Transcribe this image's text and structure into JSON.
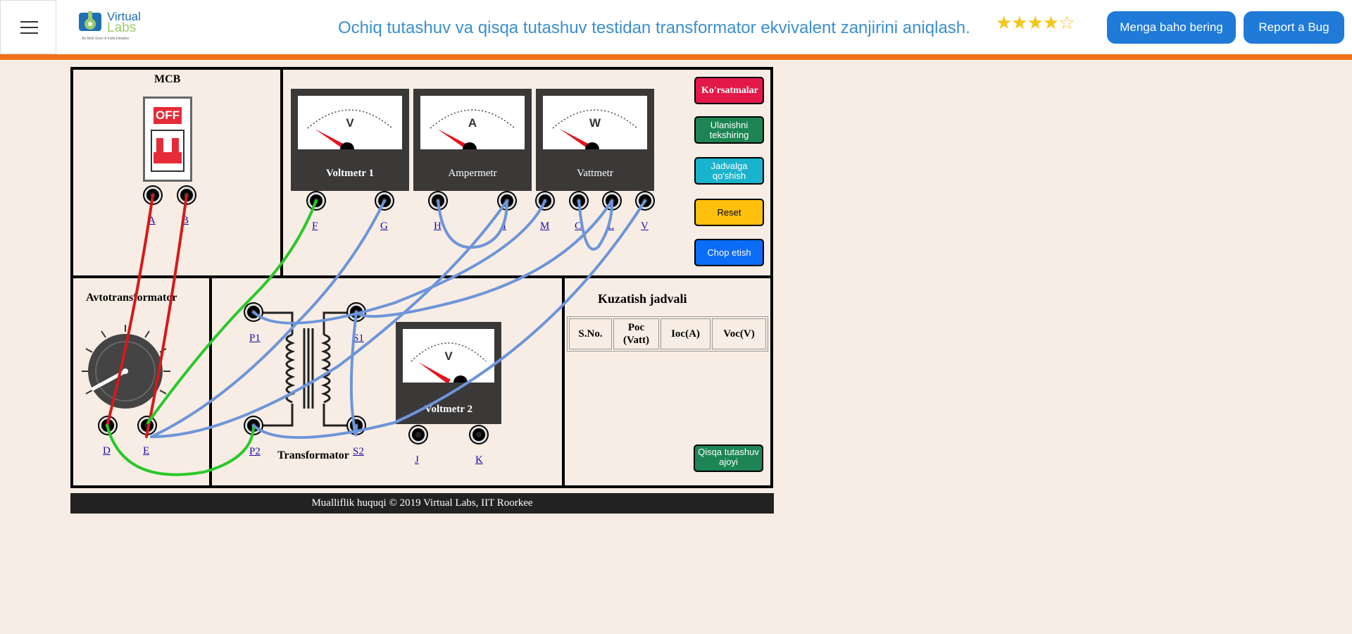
{
  "header": {
    "title": "Ochiq tutashuv va qisqa tutashuv testidan transformator ekvivalent zanjirini aniqlash.",
    "rating_stars": "★★★★☆",
    "rate_button": "Menga baho bering",
    "bug_button": "Report a Bug",
    "logo": {
      "line1": "Virtual",
      "line2": "Labs",
      "tagline": "An MoE Govt of India Initiative"
    }
  },
  "colors": {
    "accent": "#f07117",
    "primary": "#1f7ad8",
    "title": "#3a8fd0"
  },
  "lab": {
    "mcb": {
      "title": "MCB",
      "switch_text": "OFF",
      "terminals": [
        "A",
        "B"
      ]
    },
    "meters": [
      {
        "symbol": "V",
        "name": "Voltmetr 1",
        "terminals": [
          "F",
          "G"
        ]
      },
      {
        "symbol": "A",
        "name": "Ampermetr",
        "terminals": [
          "H",
          "I"
        ]
      },
      {
        "symbol": "W",
        "name": "Vattmetr",
        "terminals": [
          "M",
          "C",
          "L",
          "V"
        ]
      }
    ],
    "buttons": {
      "instructions": "Ko'rsatmalar",
      "check_connections": "Ulanishni tekshiring",
      "add_to_table": "Jadvalga qo'shish",
      "reset": "Reset",
      "print": "Chop etish",
      "short_circuit": "Qisqa tutashuv ajoyi"
    },
    "autotransformer": {
      "title": "Avtotransformator",
      "terminals": [
        "D",
        "E"
      ]
    },
    "transformer": {
      "title": "Transformator",
      "terminals": [
        "P1",
        "S1",
        "P2",
        "S2"
      ]
    },
    "voltmeter2": {
      "symbol": "V",
      "name": "Voltmetr 2",
      "terminals": [
        "J",
        "K"
      ]
    },
    "observation": {
      "title": "Kuzatish jadvali",
      "columns": [
        "S.No.",
        "Poc (Vatt)",
        "Ioc(A)",
        "Voc(V)"
      ]
    }
  },
  "footer": {
    "text": "Mualliflik huquqi © 2019 Virtual Labs, IIT Roorkee"
  }
}
